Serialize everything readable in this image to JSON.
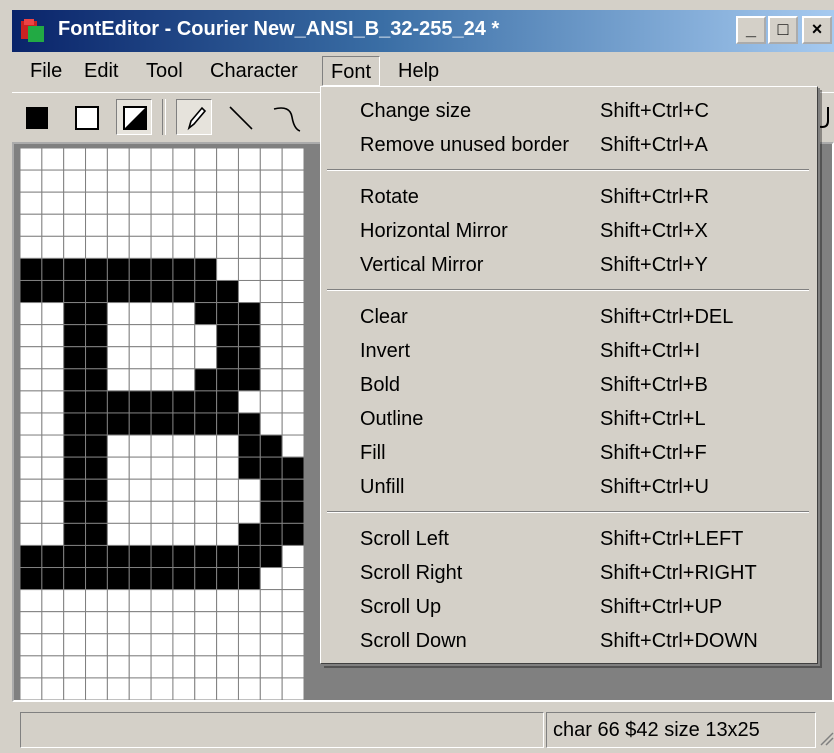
{
  "window": {
    "title": "FontEditor - Courier New_ANSI_B_32-255_24 *",
    "minimize": "_",
    "maximize": "□",
    "close": "×"
  },
  "menubar": {
    "file": "File",
    "edit": "Edit",
    "tool": "Tool",
    "character": "Character",
    "font": "Font",
    "help": "Help"
  },
  "toolbar": {
    "icons": [
      "black-fill-icon",
      "white-fill-icon",
      "invert-fill-icon",
      "pencil-icon",
      "line-icon",
      "curve-icon"
    ]
  },
  "font_menu": {
    "items": [
      {
        "label": "Change size",
        "shortcut": "Shift+Ctrl+C"
      },
      {
        "label": "Remove unused border",
        "shortcut": "Shift+Ctrl+A"
      },
      {
        "label": "Rotate",
        "shortcut": "Shift+Ctrl+R"
      },
      {
        "label": "Horizontal Mirror",
        "shortcut": "Shift+Ctrl+X"
      },
      {
        "label": "Vertical Mirror",
        "shortcut": "Shift+Ctrl+Y"
      },
      {
        "label": "Clear",
        "shortcut": "Shift+Ctrl+DEL"
      },
      {
        "label": "Invert",
        "shortcut": "Shift+Ctrl+I"
      },
      {
        "label": "Bold",
        "shortcut": "Shift+Ctrl+B"
      },
      {
        "label": "Outline",
        "shortcut": "Shift+Ctrl+L"
      },
      {
        "label": "Fill",
        "shortcut": "Shift+Ctrl+F"
      },
      {
        "label": "Unfill",
        "shortcut": "Shift+Ctrl+U"
      },
      {
        "label": "Scroll Left",
        "shortcut": "Shift+Ctrl+LEFT"
      },
      {
        "label": "Scroll Right",
        "shortcut": "Shift+Ctrl+RIGHT"
      },
      {
        "label": "Scroll Up",
        "shortcut": "Shift+Ctrl+UP"
      },
      {
        "label": "Scroll Down",
        "shortcut": "Shift+Ctrl+DOWN"
      }
    ]
  },
  "glyph": {
    "columns": 13,
    "rows": 25,
    "pixels": [
      "0000000000000",
      "0000000000000",
      "0000000000000",
      "0000000000000",
      "0000000000000",
      "1111111110000",
      "1111111111000",
      "0011000011100",
      "0011000001100",
      "0011000001100",
      "0011000011100",
      "0011111111000",
      "0011111111100",
      "0011000000110",
      "0011000000111",
      "0011000000011",
      "0011000000011",
      "0011000000111",
      "1111111111110",
      "1111111111100",
      "0000000000000",
      "0000000000000",
      "0000000000000",
      "0000000000000",
      "0000000000000"
    ]
  },
  "status": {
    "left": "",
    "char_info": "char 66 $42  size 13x25"
  },
  "colors": {
    "title_start": "#0a246a",
    "title_end": "#a6caf0",
    "face": "#d4d0c8",
    "pixel_on": "#000000",
    "pixel_off": "#ffffff",
    "grid": "#808080"
  }
}
